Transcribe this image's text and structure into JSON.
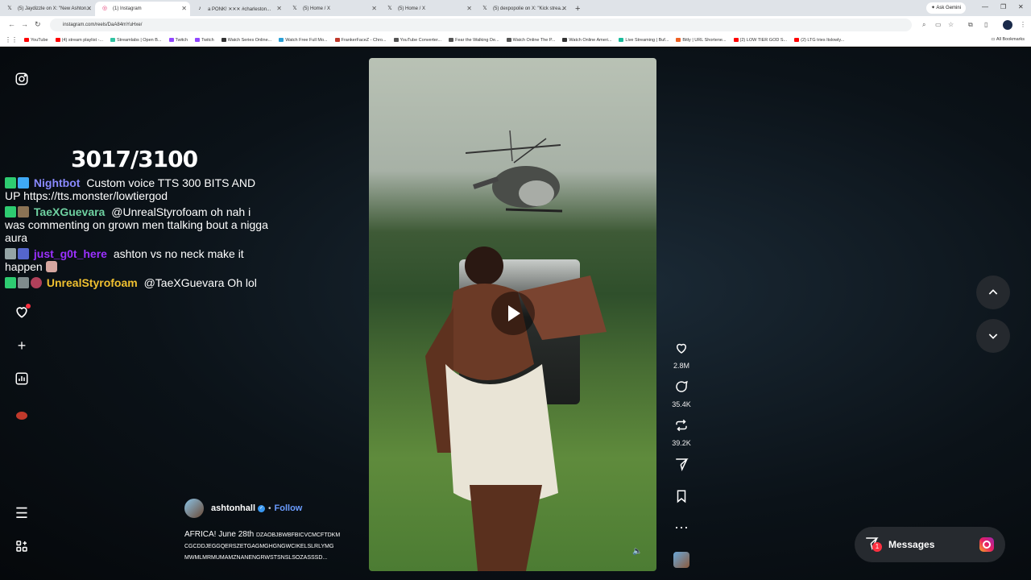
{
  "browser": {
    "tabs": [
      {
        "label": "(5) Jaydizzle on X: \"New Ashton...",
        "active": false
      },
      {
        "label": "(1) Instagram",
        "active": true
      },
      {
        "label": "a PONK! ✕✕✕ #charleston...",
        "active": false
      },
      {
        "label": "(5) Home / X",
        "active": false
      },
      {
        "label": "(5) Home / X",
        "active": false
      },
      {
        "label": "(5) dexpopolie on X: \"Kick strea...",
        "active": false
      }
    ],
    "ask_gemini": "Ask Gemini",
    "url": "instagram.com/reels/DaA84mYuHxe/",
    "bookmarks": [
      {
        "label": "YouTube",
        "color": "#ff0000"
      },
      {
        "label": "(4) stream playlist -...",
        "color": "#ff0000"
      },
      {
        "label": "Streamlabs | Open B...",
        "color": "#31c3a2"
      },
      {
        "label": "Twitch",
        "color": "#9146ff"
      },
      {
        "label": "Twitch",
        "color": "#9146ff"
      },
      {
        "label": "Watch Series Online...",
        "color": "#333333"
      },
      {
        "label": "Watch Free Full Mo...",
        "color": "#2a9fd6"
      },
      {
        "label": "FrankerFaceZ - Chro...",
        "color": "#c0392b"
      },
      {
        "label": "YouTube Converter...",
        "color": "#555555"
      },
      {
        "label": "Fear the Walking De...",
        "color": "#555555"
      },
      {
        "label": "Watch Online The P...",
        "color": "#555555"
      },
      {
        "label": "Watch Online Ameri...",
        "color": "#333333"
      },
      {
        "label": "Live Streaming | Buf...",
        "color": "#1abc9c"
      },
      {
        "label": "Bitly | URL Shortene...",
        "color": "#ee6123"
      },
      {
        "label": "(2) LOW TIER GOD S...",
        "color": "#ff0000"
      },
      {
        "label": "(2) LTG tries Itslowly...",
        "color": "#ff0000"
      }
    ],
    "all_bookmarks": "All Bookmarks"
  },
  "overlay": {
    "counter": "3017/3100",
    "chat": [
      {
        "user": "Nightbot",
        "user_color": "#8a8aff",
        "text": "Custom voice TTS 300 BITS AND UP https://tts.monster/lowtiergod"
      },
      {
        "user": "TaeXGuevara",
        "user_color": "#6ed0a0",
        "text": "@UnrealStyrofoam oh nah i was commenting on grown men ttalking bout a nigga aura"
      },
      {
        "user": "just_g0t_here",
        "user_color": "#9b30ff",
        "text": "ashton vs no neck make it happen"
      },
      {
        "user": "UnrealStyrofoam",
        "user_color": "#f0c030",
        "text": "@TaeXGuevara Oh lol"
      }
    ]
  },
  "reel": {
    "author": "ashtonhall",
    "follow_label": "Follow",
    "separator": "•",
    "caption_main": "AFRICA! June 28th",
    "caption_rest": "DZAOBJBWBFBICVCMCFTDKM CGCDDJEGGQERSZETGAGMGHGNGWCIKELSLRLYMG MWMLMRMUMAMZNANENGRWSTSNSLSOZASSSD..."
  },
  "actions": {
    "likes": "2.8M",
    "comments": "35.4K",
    "reposts": "39.2K"
  },
  "messages": {
    "label": "Messages",
    "badge": "1"
  }
}
